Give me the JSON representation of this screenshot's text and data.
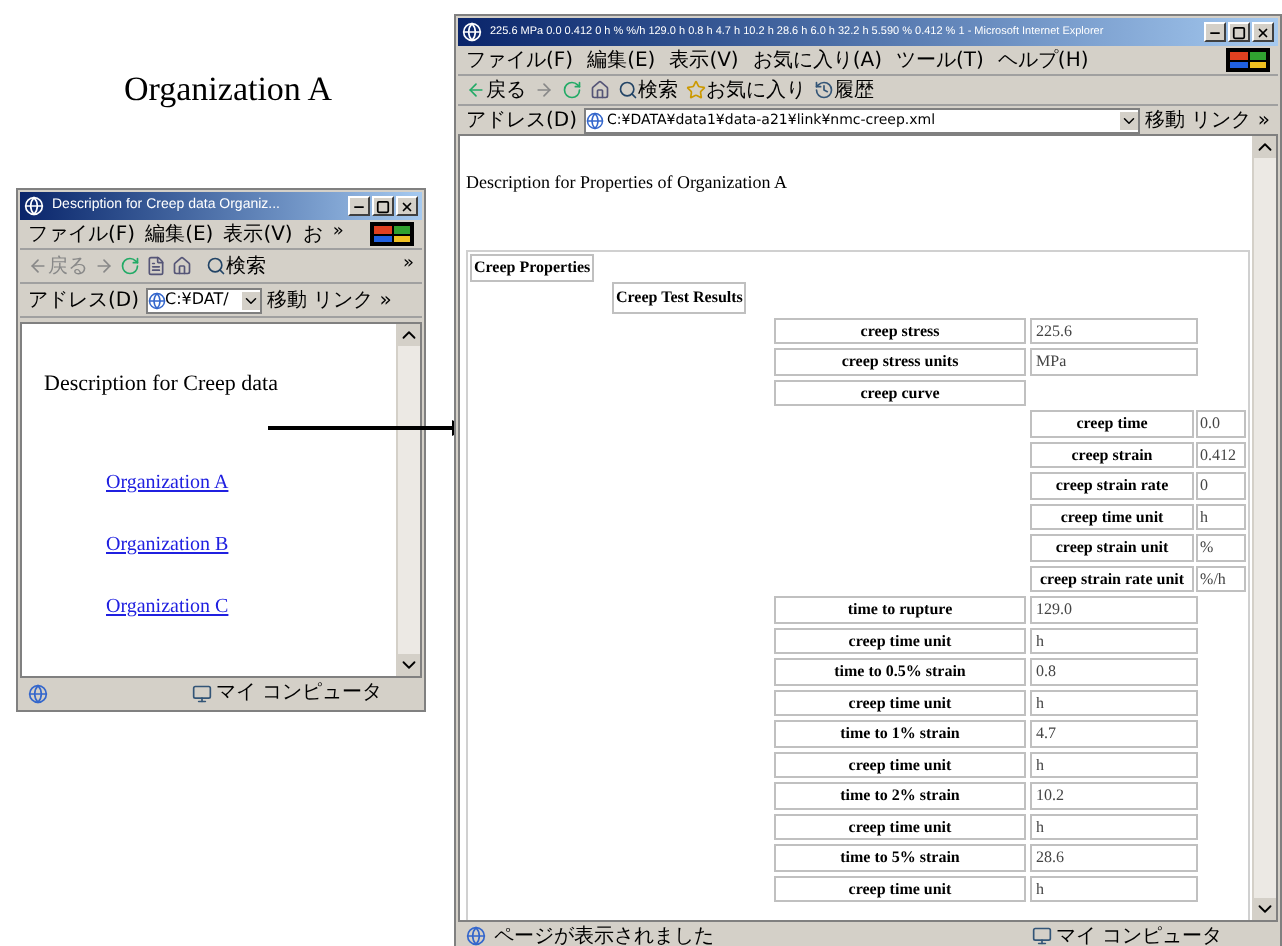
{
  "caption": "Organization A",
  "small_window": {
    "title": "Description for Creep data Organiz...",
    "menu": [
      "ファイル(F)",
      "編集(E)",
      "表示(V)",
      "お"
    ],
    "menu_overflow": "»",
    "toolbar": {
      "back": "戻る",
      "search": "検索",
      "overflow": "»"
    },
    "address": {
      "label": "アドレス(D)",
      "value": "C:¥DAT/",
      "go": "移動",
      "links": "リンク »"
    },
    "description": "Description for Creep data",
    "links": [
      {
        "label": "Organization A"
      },
      {
        "label": "Organization B"
      },
      {
        "label": "Organization C"
      }
    ],
    "status": {
      "zone": "マイ コンピュータ"
    }
  },
  "big_window": {
    "title": "225.6 MPa 0.0 0.412 0 h % %/h 129.0 h 0.8 h 4.7 h 10.2 h 28.6 h 6.0 h 32.2 h 5.590 % 0.412 % 1 - Microsoft Internet Explorer",
    "menu": [
      "ファイル(F)",
      "編集(E)",
      "表示(V)",
      "お気に入り(A)",
      "ツール(T)",
      "ヘルプ(H)"
    ],
    "toolbar": {
      "back": "戻る",
      "search": "検索",
      "favorites": "お気に入り",
      "history": "履歴"
    },
    "address": {
      "label": "アドレス(D)",
      "value": "C:¥DATA¥data1¥data-a21¥link¥nmc-creep.xml",
      "go": "移動",
      "links": "リンク »"
    },
    "description": "Description for Properties of Organization A",
    "section": "Creep Properties",
    "subsection": "Creep Test Results",
    "rows": [
      {
        "kind": "pair",
        "label": "creep stress",
        "value": "225.6"
      },
      {
        "kind": "pair",
        "label": "creep stress units",
        "value": "MPa"
      },
      {
        "kind": "group",
        "label": "creep curve",
        "children": [
          {
            "label": "creep time",
            "value": "0.0"
          },
          {
            "label": "creep strain",
            "value": "0.412"
          },
          {
            "label": "creep strain rate",
            "value": "0"
          },
          {
            "label": "creep time unit",
            "value": "h"
          },
          {
            "label": "creep strain unit",
            "value": "%"
          },
          {
            "label": "creep strain rate unit",
            "value": "%/h"
          }
        ]
      },
      {
        "kind": "pair",
        "label": "time to rupture",
        "value": "129.0"
      },
      {
        "kind": "pair",
        "label": "creep time unit",
        "value": "h"
      },
      {
        "kind": "pair",
        "label": "time to 0.5% strain",
        "value": "0.8"
      },
      {
        "kind": "pair",
        "label": "creep time unit",
        "value": "h"
      },
      {
        "kind": "pair",
        "label": "time to 1% strain",
        "value": "4.7"
      },
      {
        "kind": "pair",
        "label": "creep time unit",
        "value": "h"
      },
      {
        "kind": "pair",
        "label": "time to 2% strain",
        "value": "10.2"
      },
      {
        "kind": "pair",
        "label": "creep time unit",
        "value": "h"
      },
      {
        "kind": "pair",
        "label": "time to 5% strain",
        "value": "28.6"
      },
      {
        "kind": "pair",
        "label": "creep time unit",
        "value": "h"
      }
    ],
    "status": {
      "message": "ページが表示されました",
      "zone": "マイ コンピュータ"
    }
  }
}
